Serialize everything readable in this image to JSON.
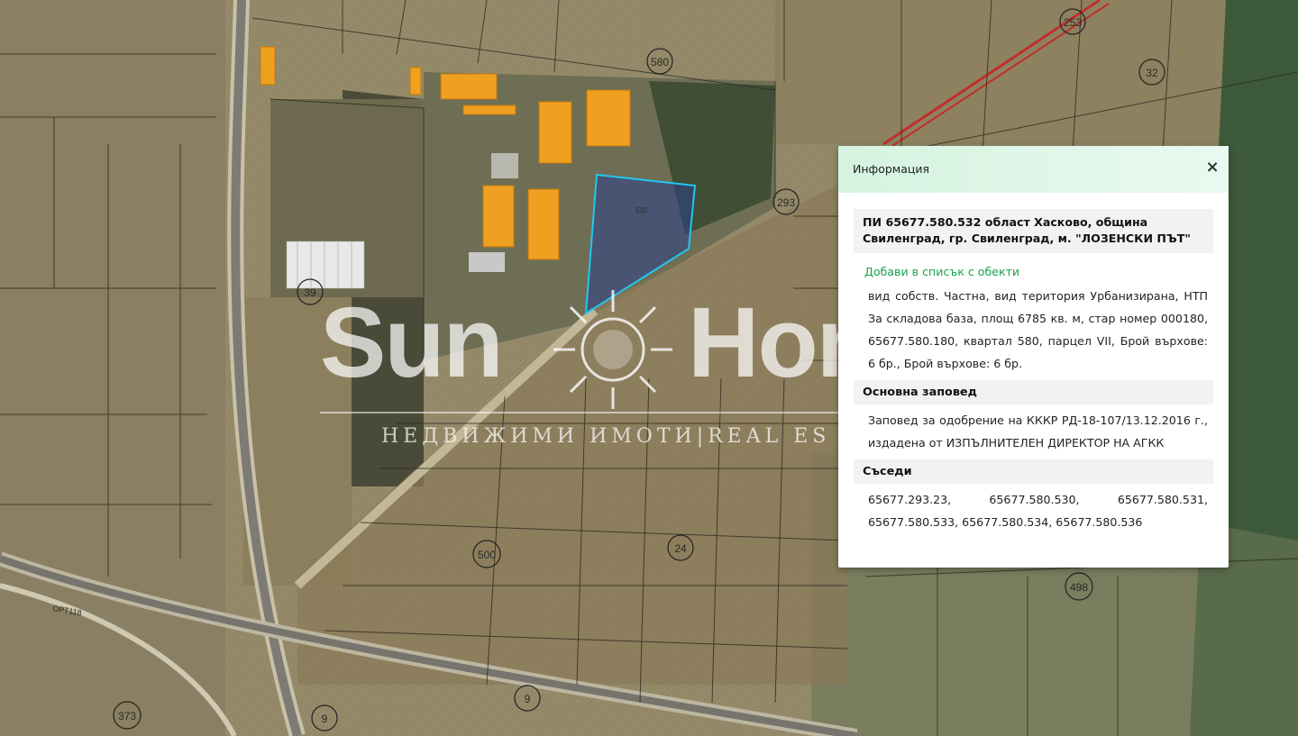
{
  "map": {
    "circle_labels": [
      "580",
      "253",
      "32",
      "293",
      "39",
      "500",
      "24",
      "498",
      "9",
      "373",
      "9"
    ],
    "road_label": "ОРТ118",
    "parcel_label": "532"
  },
  "watermark": {
    "brand_left": "Sun",
    "brand_right": "Hom",
    "subtitle": "НЕДВИЖИМИ ИМОТИ|REAL ES"
  },
  "panel": {
    "title": "Информация",
    "close_symbol": "×",
    "property_title": "ПИ 65677.580.532 област Хасково, община Свиленград, гр. Свиленград, м. \"ЛОЗЕНСКИ ПЪТ\"",
    "add_link": "Добави в списък с обекти",
    "details": "вид собств. Частна, вид територия Урбанизирана, НТП За складова база, площ 6785 кв. м, стар номер 000180, 65677.580.180, квартал 580, парцел VII, Брой върхове: 6 бр., Брой върхове: 6 бр.",
    "order_heading": "Основна заповед",
    "order_text": "Заповед за одобрение на КККР РД-18-107/13.12.2016 г., издадена от ИЗПЪЛНИТЕЛЕН ДИРЕКТОР НА АГКК",
    "neighbors_heading": "Съседи",
    "neighbors_line1": [
      "65677.293.23,",
      "65677.580.530,",
      "65677.580.531,"
    ],
    "neighbors_line2": "65677.580.533, 65677.580.534, 65677.580.536"
  },
  "colors": {
    "accent_green": "#1aa34a",
    "parcel_outline": "#22c7f0",
    "building": "#f0a020"
  }
}
